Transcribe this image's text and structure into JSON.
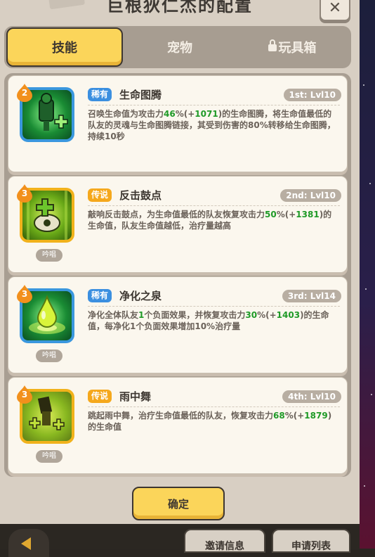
{
  "dialog": {
    "title": "巨根狄仁杰的配置",
    "close_symbol": "✕"
  },
  "tabs": [
    {
      "label": "技能",
      "active": true
    },
    {
      "label": "宠物",
      "active": false
    },
    {
      "label": "玩具箱",
      "active": false,
      "locked": true
    }
  ],
  "skills": [
    {
      "level": "2",
      "rarity": "稀有",
      "name": "生命图腾",
      "slot": "1st: Lvl10",
      "desc_parts": [
        {
          "t": "召唤生命值为攻击力"
        },
        {
          "t": "46",
          "g": true
        },
        {
          "t": "%(+"
        },
        {
          "t": "1071",
          "g": true
        },
        {
          "t": ")的生命图腾，将生命值最低的队友的灵魂与生命图腾链接，其受到伤害的80%转移给生命图腾，持续10秒"
        }
      ],
      "icon": "life-totem-icon",
      "frame": "rare",
      "chant": null
    },
    {
      "level": "3",
      "rarity": "传说",
      "name": "反击鼓点",
      "slot": "2nd: Lvl10",
      "desc_parts": [
        {
          "t": "敲响反击鼓点，为生命值最低的队友恢复攻击力"
        },
        {
          "t": "50",
          "g": true
        },
        {
          "t": "%(+"
        },
        {
          "t": "1381",
          "g": true
        },
        {
          "t": ")的生命值，队友生命值越低，治疗量越高"
        }
      ],
      "icon": "drum-icon",
      "frame": "legend",
      "chant": "吟唱"
    },
    {
      "level": "3",
      "rarity": "稀有",
      "name": "净化之泉",
      "slot": "3rd: Lvl14",
      "desc_parts": [
        {
          "t": "净化全体队友"
        },
        {
          "t": "1",
          "g": true
        },
        {
          "t": "个负面效果，并恢复攻击力"
        },
        {
          "t": "30",
          "g": true
        },
        {
          "t": "%(+"
        },
        {
          "t": "1403",
          "g": true
        },
        {
          "t": ")的生命值，每净化1个负面效果增加10%治疗量"
        }
      ],
      "icon": "spring-drop-icon",
      "frame": "rare",
      "chant": "吟唱"
    },
    {
      "level": "3",
      "rarity": "传说",
      "name": "雨中舞",
      "slot": "4th: Lvl10",
      "desc_parts": [
        {
          "t": "跳起雨中舞，治疗生命值最低的队友，恢复攻击力"
        },
        {
          "t": "68",
          "g": true
        },
        {
          "t": "%(+"
        },
        {
          "t": "1879",
          "g": true
        },
        {
          "t": ")的生命值"
        }
      ],
      "icon": "rain-dance-icon",
      "frame": "legend",
      "chant": "吟唱"
    }
  ],
  "confirm_label": "确定",
  "bottom": {
    "invite_label": "邀请信息",
    "apply_label": "申请列表"
  },
  "colors": {
    "accent_yellow": "#fbd55a",
    "rare_blue": "#3b8fe0",
    "legend_orange": "#f5a81c",
    "value_green": "#1f9a27"
  }
}
